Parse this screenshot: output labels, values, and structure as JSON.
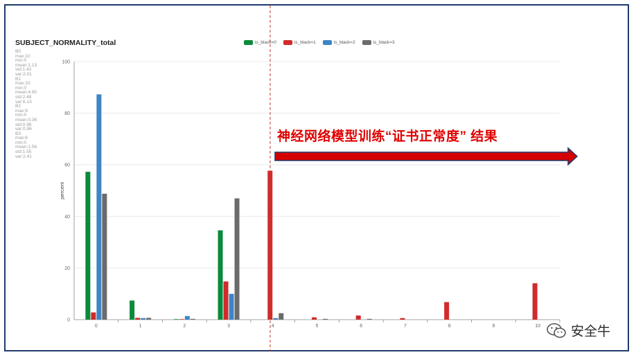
{
  "chart_data": {
    "type": "bar",
    "title": "SUBJECT_NORMALITY_total",
    "ylabel": "percent",
    "xlabel": "",
    "ylim": [
      0,
      100
    ],
    "yticks": [
      "0",
      "20",
      "40",
      "60",
      "80",
      "100"
    ],
    "categories": [
      "0",
      "1",
      "2",
      "3",
      "4",
      "5",
      "6",
      "7",
      "8",
      "9",
      "10"
    ],
    "grid": true,
    "legend_position": "top",
    "series": [
      {
        "name": "is_black=0",
        "color": "#0a8a3a",
        "values": [
          57.3,
          7.4,
          0.2,
          34.6,
          0,
          0,
          0,
          0,
          0,
          0,
          0
        ]
      },
      {
        "name": "is_black=1",
        "color": "#d22a2a",
        "values": [
          2.8,
          0.7,
          0.2,
          14.8,
          57.7,
          0.9,
          1.6,
          0.6,
          6.8,
          0,
          14.1
        ]
      },
      {
        "name": "is_black=2",
        "color": "#3d85c6",
        "values": [
          87.3,
          0.6,
          1.4,
          10,
          0.6,
          0,
          0,
          0,
          0,
          0,
          0
        ]
      },
      {
        "name": "is_black=3",
        "color": "#6b6b6b",
        "values": [
          48.8,
          0.7,
          0.3,
          47,
          2.5,
          0.3,
          0.3,
          0,
          0,
          0,
          0
        ]
      }
    ],
    "stats_text": [
      "B0",
      "max:10",
      "min:0",
      "mean:1.13",
      "std:1.42",
      "var:2.01",
      "B1",
      "max:10",
      "min:0",
      "mean:4.90",
      "std:2.48",
      "var:6.13",
      "B2",
      "max:9",
      "min:0",
      "mean:0.36",
      "std:0.98",
      "var:0.96",
      "B3",
      "max:6",
      "min:0",
      "mean:1.56",
      "std:1.55",
      "var:2.41"
    ]
  },
  "annotation": {
    "text": "神经网络模型训练“证书正常度” 结果",
    "color": "#e00000",
    "arrow_fill": "#d40000",
    "arrow_stroke": "#1f3a6b"
  },
  "watermark": {
    "text": "安全牛",
    "icon": "wechat-icon"
  },
  "colors": {
    "frame": "#1f3a6b",
    "divider": "#c0392b",
    "grid": "#e4e4e4"
  }
}
